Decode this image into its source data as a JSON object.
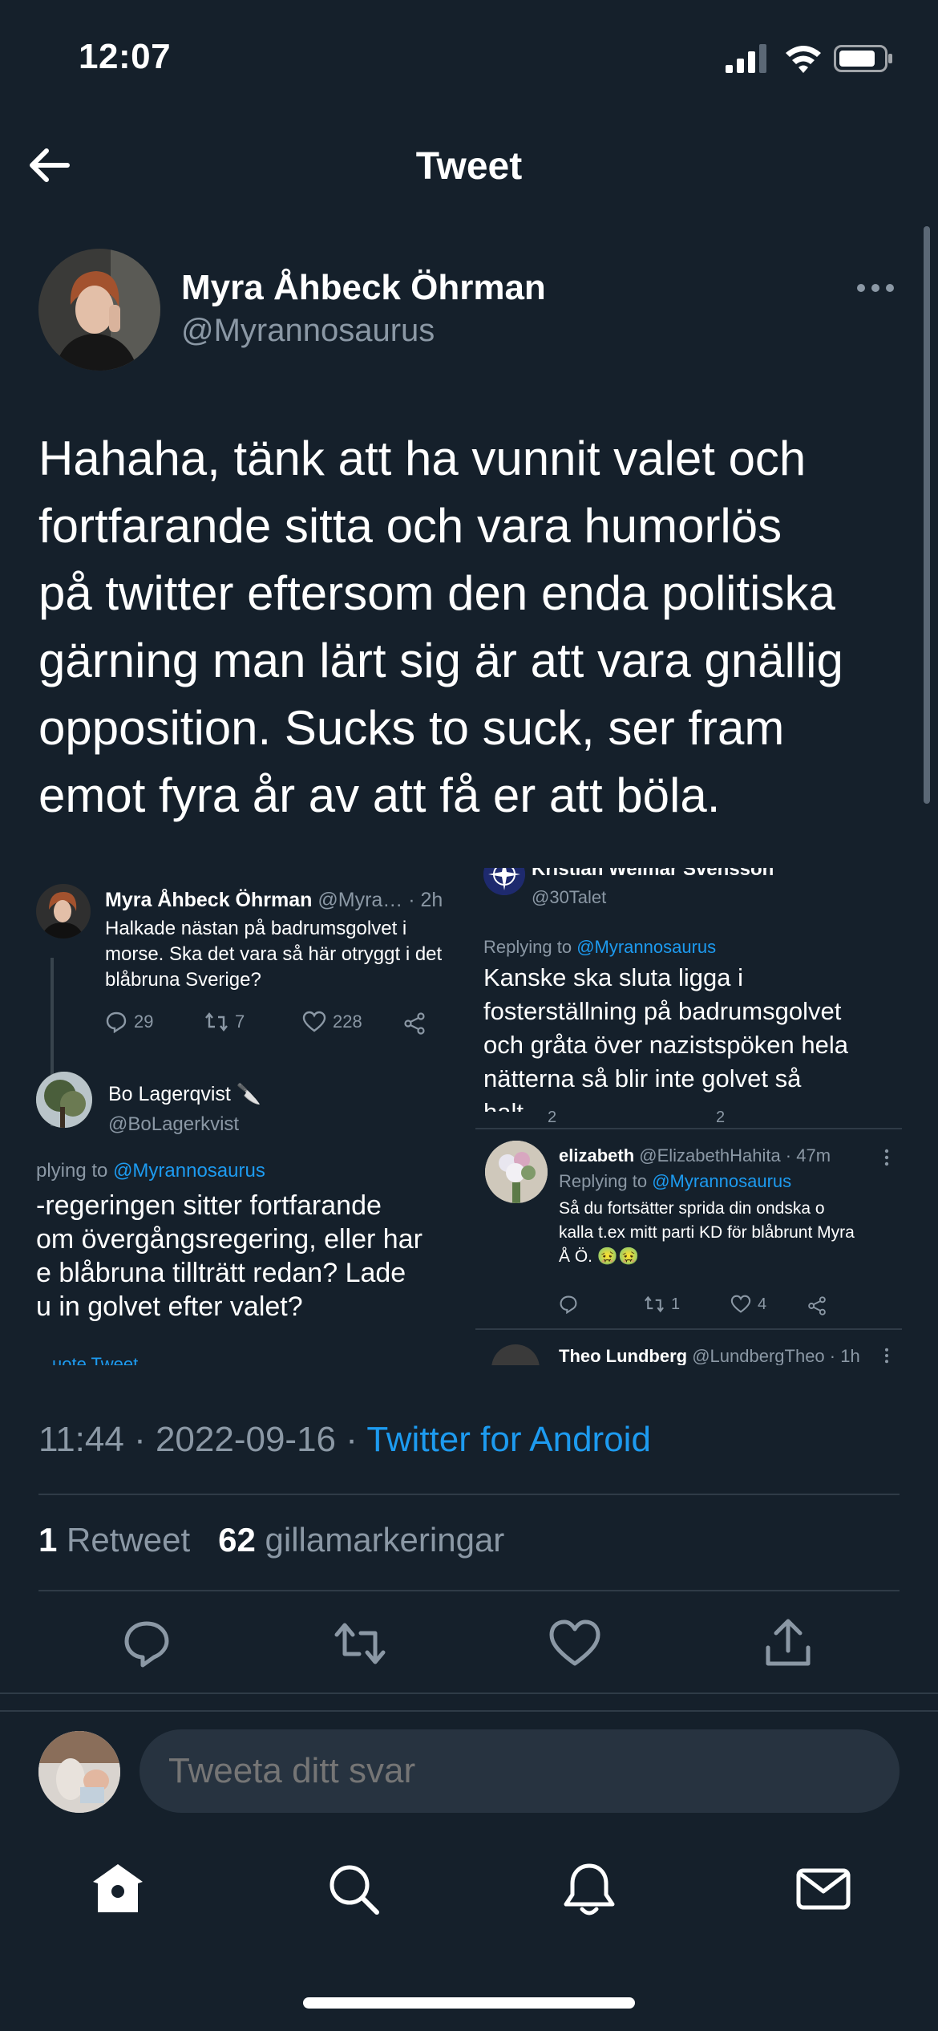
{
  "status_bar": {
    "time": "12:07"
  },
  "nav": {
    "title": "Tweet"
  },
  "author": {
    "name": "Myra Åhbeck Öhrman",
    "handle": "@Myrannosaurus"
  },
  "tweet": {
    "text": "Hahaha, tänk att ha vunnit valet och\nfortfarande sitta och vara humorlös\npå twitter eftersom den enda politiska\ngärning man lärt sig är att vara gnällig\nopposition. Sucks to suck, ser fram\nemot fyra år av att få er att böla."
  },
  "embedded_image": {
    "left_panel": {
      "tweet1": {
        "name": "Myra Åhbeck Öhrman",
        "handle_time": "@Myra… · 2h",
        "text_lines": [
          "Halkade nästan på badrumsgolvet i",
          "morse. Ska det vara så här otryggt i det",
          "blåbruna Sverige?"
        ],
        "replies": "29",
        "retweets": "7",
        "likes": "228"
      },
      "tweet2": {
        "name": "Bo Lagerqvist 🔪",
        "handle": "@BoLagerkvist",
        "replying_prefix": "plying to ",
        "replying_handle": "@Myrannosaurus",
        "text_lines": [
          "-regeringen sitter fortfarande",
          "om övergångsregering, eller har",
          "e blåbruna tillträtt redan? Lade",
          "u in golvet efter valet?"
        ],
        "footer": "uote Tweet"
      }
    },
    "right_panel": {
      "tweet1": {
        "name": "Kristian Weimar Svensson",
        "handle": "@30Talet",
        "replying_prefix": "Replying to ",
        "replying_handle": "@Myrannosaurus",
        "text_lines": [
          "Kanske ska sluta ligga i",
          "fosterställning på badrumsgolvet",
          "och gråta över nazistspöken hela",
          "nätterna så blir inte golvet så",
          "halt."
        ],
        "partial_counts": [
          "2",
          "2"
        ]
      },
      "tweet2": {
        "name": "elizabeth",
        "handle_time": "@ElizabethHahita · 47m",
        "replying_prefix": "Replying to ",
        "replying_handle": "@Myrannosaurus",
        "text_lines": [
          "Så du fortsätter sprida din ondska o",
          "kalla t.ex mitt parti KD för blåbrunt Myra",
          "Å Ö. 🤢🤢"
        ],
        "retweets": "1",
        "likes": "4"
      },
      "tweet3": {
        "name": "Theo Lundberg",
        "handle_time": "@LundbergTheo · 1h"
      }
    }
  },
  "meta": {
    "time_date": "11:44 · 2022-09-16 · ",
    "source": "Twitter for Android"
  },
  "stats": {
    "retweets_count": "1",
    "retweets_label": "Retweet",
    "likes_count": "62",
    "likes_label": "gillamarkeringar"
  },
  "reply": {
    "placeholder": "Tweeta ditt svar"
  },
  "icons": {
    "back": "arrow-left-icon",
    "more": "more-horizontal-icon",
    "reply": "reply-icon",
    "retweet": "retweet-icon",
    "like": "heart-icon",
    "share": "share-icon",
    "home": "home-icon",
    "search": "search-icon",
    "notifications": "bell-icon",
    "messages": "mail-icon"
  },
  "colors": {
    "background": "#15202b",
    "accent": "#1d9bf0",
    "secondary_text": "#8b98a5"
  }
}
